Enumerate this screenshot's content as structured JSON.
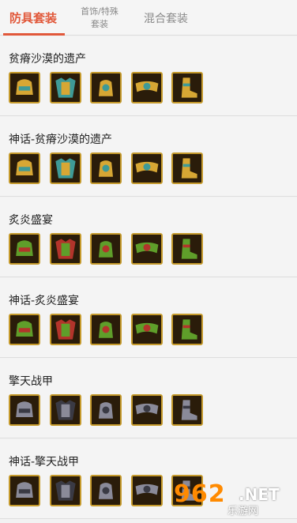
{
  "tabs": [
    {
      "label": "防具套装",
      "active": true
    },
    {
      "label_line1": "首饰/特殊",
      "label_line2": "套装",
      "active": false
    },
    {
      "label": "混合套装",
      "active": false
    }
  ],
  "sets": [
    {
      "title": "贫瘠沙漠的遗产",
      "icons": [
        "desert-helm-icon",
        "desert-chest-icon",
        "desert-gauntlet-icon",
        "desert-belt-icon",
        "desert-boots-icon"
      ],
      "palette": "gold"
    },
    {
      "title": "神话-贫瘠沙漠的遗产",
      "icons": [
        "desert-helm-icon",
        "desert-chest-icon",
        "desert-gauntlet-icon",
        "desert-belt-icon",
        "desert-boots-icon"
      ],
      "palette": "gold"
    },
    {
      "title": "炙炎盛宴",
      "icons": [
        "feast-helm-icon",
        "feast-chest-icon",
        "feast-gauntlet-icon",
        "feast-belt-icon",
        "feast-boots-icon"
      ],
      "palette": "green"
    },
    {
      "title": "神话-炙炎盛宴",
      "icons": [
        "feast-helm-icon",
        "feast-chest-icon",
        "feast-gauntlet-icon",
        "feast-belt-icon",
        "feast-boots-icon"
      ],
      "palette": "green"
    },
    {
      "title": "擎天战甲",
      "icons": [
        "mech-helm-icon",
        "mech-chest-icon",
        "mech-gauntlet-icon",
        "mech-belt-icon",
        "mech-boots-icon"
      ],
      "palette": "steel"
    },
    {
      "title": "神话-擎天战甲",
      "icons": [
        "mech-helm-icon",
        "mech-chest-icon",
        "mech-gauntlet-icon",
        "mech-belt-icon",
        "mech-boots-icon"
      ],
      "palette": "steel"
    }
  ],
  "colors": {
    "accent": "#e1583a",
    "gold": "#d7a734",
    "green": "#5f9e2a",
    "steel": "#8a8a99",
    "teal": "#3e9a97",
    "red": "#b3342b"
  },
  "watermark": {
    "number": "962",
    "suffix": ".NET",
    "subtitle": "乐游网"
  }
}
